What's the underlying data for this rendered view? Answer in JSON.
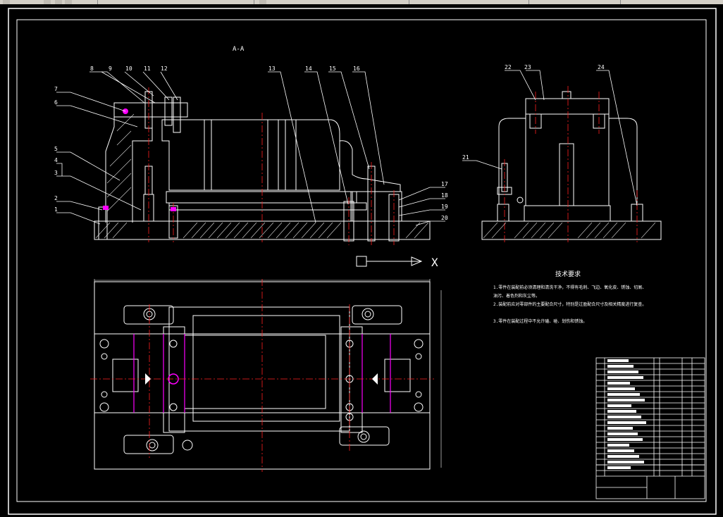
{
  "section_label": "A-A",
  "tech_title": "技术要求",
  "tech_lines": [
    "1.零件在装配前必须清理和清洗干净，不得有毛刺、飞边、氧化皮、锈蚀、切屑、",
    "油污、着色剂和灰尘等。",
    "2.装配前应对零部件的主要配合尺寸，特别是过盈配合尺寸及相关精度进行复查。",
    "3.零件在装配过程中不允许磕、碰、划伤和锈蚀。"
  ],
  "balloons_front": [
    "8",
    "9",
    "10",
    "11",
    "12",
    "7",
    "6",
    "5",
    "4",
    "3",
    "2",
    "1",
    "13",
    "14",
    "15",
    "16",
    "17",
    "18",
    "19",
    "20"
  ],
  "balloons_side": [
    "22",
    "23",
    "24",
    "21"
  ],
  "axis_label": "X",
  "colors": {
    "line": "#ffffff",
    "center": "#ff2020",
    "magenta": "#ff00ff",
    "bg": "#000000",
    "toolbar": "#d4d0c8"
  }
}
